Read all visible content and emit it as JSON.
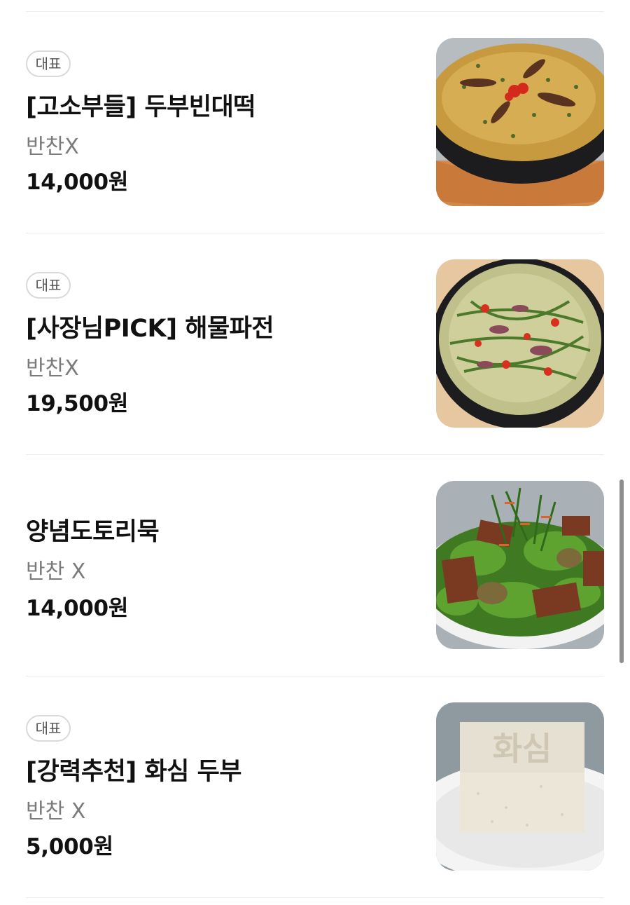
{
  "menu": {
    "items": [
      {
        "badge": "대표",
        "name": "[고소부들] 두부빈대떡",
        "desc": "반찬X",
        "price": "14,000원",
        "image_icon": "bindaetteok-photo"
      },
      {
        "badge": "대표",
        "name": "[사장님PICK] 해물파전",
        "desc": "반찬X",
        "price": "19,500원",
        "image_icon": "haemul-pajeon-photo"
      },
      {
        "badge": "",
        "name": "양념도토리묵",
        "desc": "반찬 X",
        "price": "14,000원",
        "image_icon": "dotorimuk-photo"
      },
      {
        "badge": "대표",
        "name": "[강력추천] 화심 두부",
        "desc": "반찬 X",
        "price": "5,000원",
        "image_icon": "tofu-photo",
        "image_text": "화심"
      }
    ]
  }
}
